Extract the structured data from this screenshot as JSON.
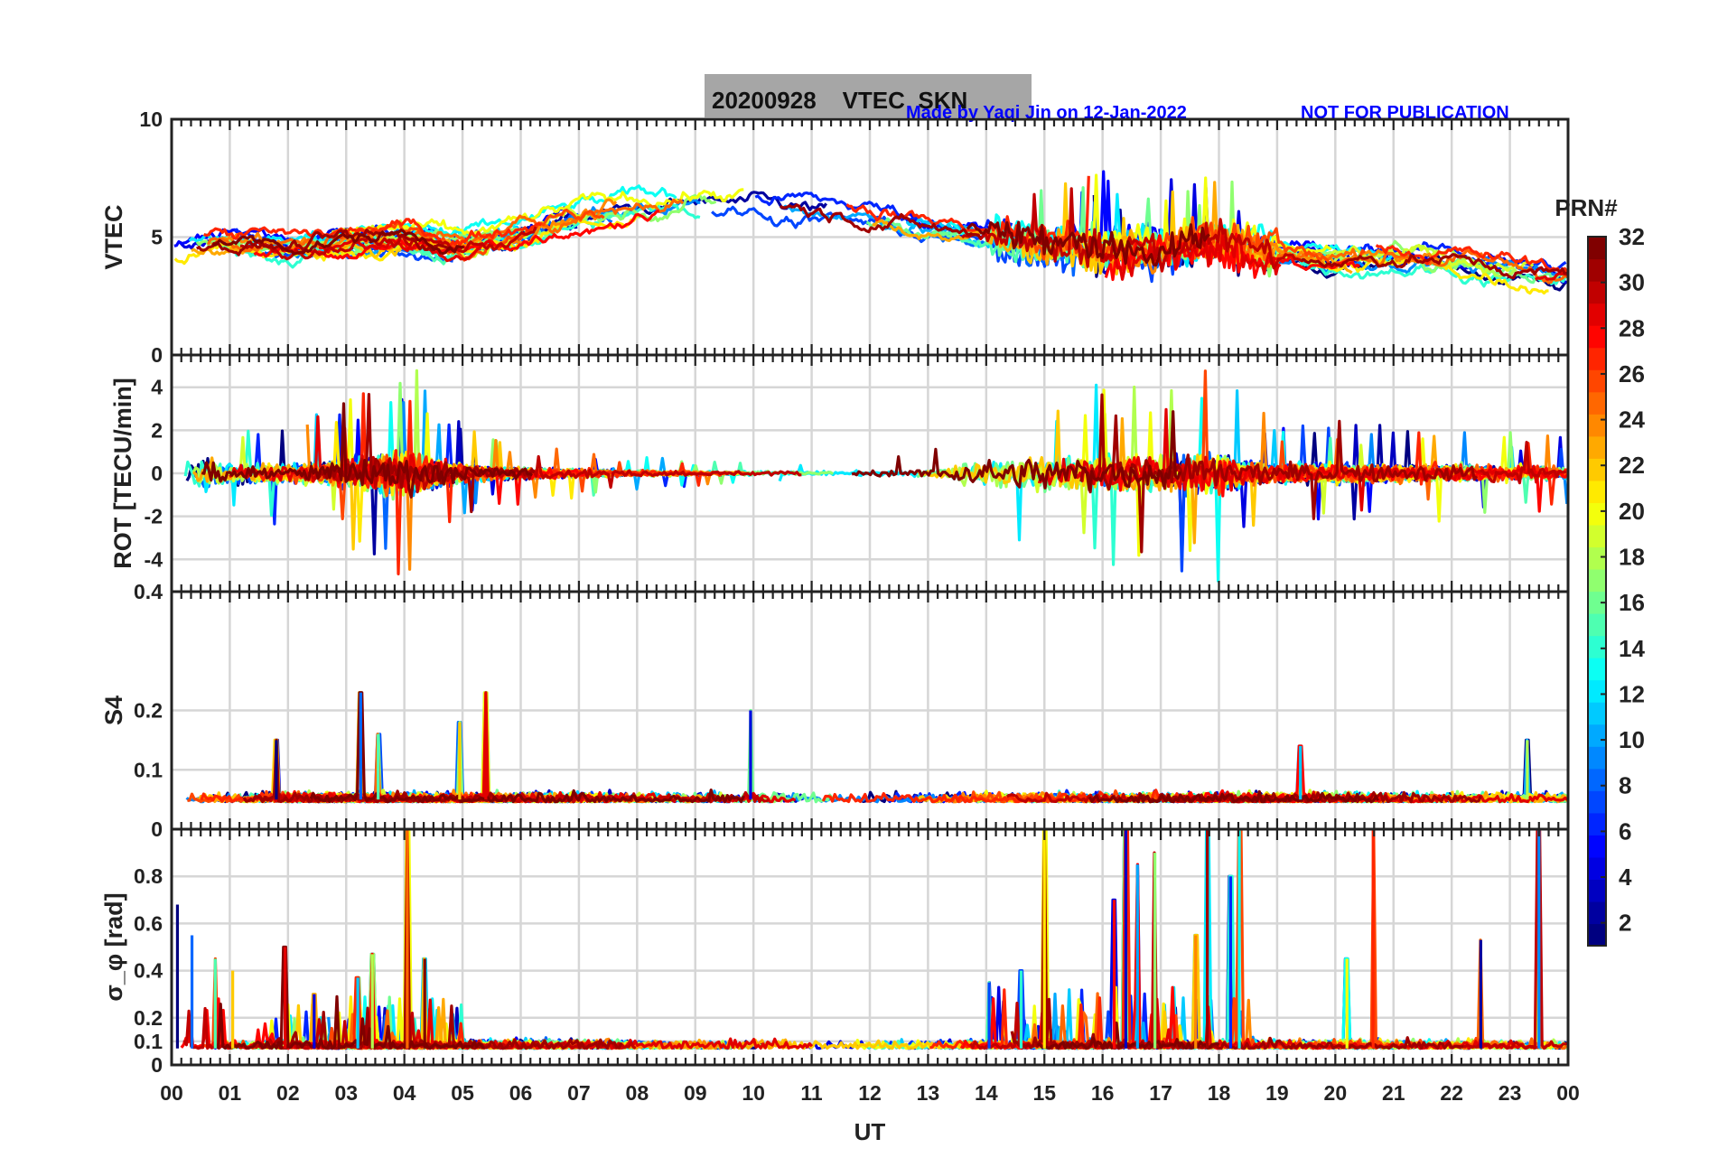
{
  "header": {
    "title": "20200928    VTEC  SKN",
    "credit": "Made by Yaqi Jin on 12-Jan-2022",
    "notice": "NOT FOR PUBLICATION",
    "title_box_color": "#a6a6a6",
    "credit_color": "#0000ff"
  },
  "colorbar": {
    "label": "PRN#",
    "ticks": [
      "2",
      "4",
      "6",
      "8",
      "10",
      "12",
      "14",
      "16",
      "18",
      "20",
      "22",
      "24",
      "26",
      "28",
      "30",
      "32"
    ],
    "range": [
      1,
      32
    ],
    "colormap": "jet"
  },
  "xaxis": {
    "label": "UT",
    "ticks": [
      "00",
      "01",
      "02",
      "03",
      "04",
      "05",
      "06",
      "07",
      "08",
      "09",
      "10",
      "11",
      "12",
      "13",
      "14",
      "15",
      "16",
      "17",
      "18",
      "19",
      "20",
      "21",
      "22",
      "23",
      "00"
    ],
    "range": [
      0,
      24
    ]
  },
  "chart_data": [
    {
      "type": "line",
      "panel": "VTEC",
      "ylabel": "VTEC",
      "ylim": [
        0,
        10
      ],
      "yticks": [
        "0",
        "5",
        "10"
      ],
      "grid": true,
      "series_note": "one line per GPS PRN 1-32, colored by colorbar",
      "typical_level": [
        [
          0,
          4.5
        ],
        [
          1,
          4.8
        ],
        [
          2,
          4.6
        ],
        [
          3,
          4.8
        ],
        [
          4,
          5.0
        ],
        [
          5,
          4.6
        ],
        [
          6,
          5.2
        ],
        [
          7,
          5.9
        ],
        [
          8,
          6.3
        ],
        [
          9,
          6.5
        ],
        [
          10,
          6.4
        ],
        [
          11,
          6.2
        ],
        [
          12,
          5.9
        ],
        [
          13,
          5.4
        ],
        [
          14,
          5.0
        ],
        [
          15,
          4.6
        ],
        [
          16,
          4.4
        ],
        [
          17,
          4.6
        ],
        [
          18,
          4.8
        ],
        [
          19,
          4.2
        ],
        [
          20,
          4.0
        ],
        [
          21,
          4.2
        ],
        [
          22,
          4.0
        ],
        [
          23,
          3.6
        ],
        [
          24,
          3.3
        ]
      ]
    },
    {
      "type": "line",
      "panel": "ROT",
      "ylabel": "ROT [TECU/min]",
      "ylim": [
        -5.5,
        5.5
      ],
      "yticks": [
        "-4",
        "-2",
        "0",
        "2",
        "4"
      ],
      "grid": true,
      "series_note": "one line per GPS PRN 1-32, colored by colorbar",
      "fluctuation_amplitude": [
        [
          0,
          2.0
        ],
        [
          1,
          1.0
        ],
        [
          2,
          0.8
        ],
        [
          3,
          1.2
        ],
        [
          4,
          2.0
        ],
        [
          5,
          0.8
        ],
        [
          6,
          0.5
        ],
        [
          7,
          0.4
        ],
        [
          8,
          0.3
        ],
        [
          9,
          0.2
        ],
        [
          10,
          0.2
        ],
        [
          11,
          0.2
        ],
        [
          12,
          0.25
        ],
        [
          13,
          0.35
        ],
        [
          14,
          1.3
        ],
        [
          15,
          1.6
        ],
        [
          16,
          1.5
        ],
        [
          17,
          1.6
        ],
        [
          18,
          1.8
        ],
        [
          19,
          0.8
        ],
        [
          20,
          0.9
        ],
        [
          21,
          0.8
        ],
        [
          22,
          0.8
        ],
        [
          23,
          0.7
        ],
        [
          24,
          0.6
        ]
      ]
    },
    {
      "type": "line",
      "panel": "S4",
      "ylabel": "S4",
      "ylim": [
        0,
        0.4
      ],
      "yticks": [
        "0",
        "0.1",
        "0.2",
        "0.4"
      ],
      "grid": true,
      "series_note": "one line per GPS PRN 1-32, colored by colorbar",
      "baseline": 0.05,
      "peaks": [
        [
          1.8,
          0.15
        ],
        [
          3.25,
          0.23
        ],
        [
          3.55,
          0.16
        ],
        [
          4.95,
          0.18
        ],
        [
          5.4,
          0.23
        ],
        [
          9.95,
          0.2
        ],
        [
          19.4,
          0.14
        ],
        [
          23.3,
          0.15
        ]
      ]
    },
    {
      "type": "line",
      "panel": "sigma_phi",
      "ylabel": "σ_φ [rad]",
      "ylim": [
        0,
        1.0
      ],
      "yticks": [
        "0",
        "0.1",
        "0.2",
        "0.4",
        "0.6",
        "0.8"
      ],
      "grid": true,
      "series_note": "one line per GPS PRN 1-32, colored by colorbar",
      "baseline": 0.07,
      "peaks": [
        [
          0.1,
          0.68
        ],
        [
          0.35,
          0.55
        ],
        [
          0.75,
          0.45
        ],
        [
          1.05,
          0.4
        ],
        [
          1.95,
          0.5
        ],
        [
          2.45,
          0.3
        ],
        [
          3.2,
          0.37
        ],
        [
          3.45,
          0.47
        ],
        [
          4.05,
          1.0
        ],
        [
          4.35,
          0.45
        ],
        [
          14.05,
          0.35
        ],
        [
          14.6,
          0.4
        ],
        [
          15.0,
          1.0
        ],
        [
          16.2,
          0.7
        ],
        [
          16.4,
          1.0
        ],
        [
          16.6,
          0.85
        ],
        [
          16.9,
          0.9
        ],
        [
          17.6,
          0.55
        ],
        [
          17.8,
          1.0
        ],
        [
          18.2,
          0.8
        ],
        [
          18.35,
          1.0
        ],
        [
          20.2,
          0.45
        ],
        [
          20.65,
          1.0
        ],
        [
          22.5,
          0.53
        ],
        [
          23.5,
          1.0
        ]
      ]
    }
  ]
}
